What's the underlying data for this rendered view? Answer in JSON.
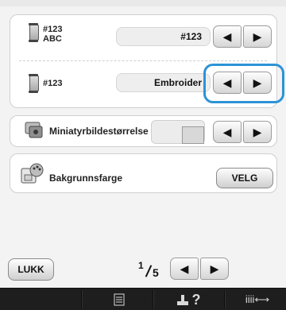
{
  "rows": [
    {
      "label_line1": "#123",
      "label_line2": "ABC",
      "value": "#123"
    },
    {
      "label": "#123",
      "value": "Embroider"
    },
    {
      "label": "Miniatyrbildestørrelse"
    },
    {
      "label": "Bakgrunnsfarge",
      "button": "VELG"
    }
  ],
  "footer": {
    "close_label": "LUKK",
    "page_current": "1",
    "page_total": "5"
  },
  "icons": {
    "left_arrow": "◀",
    "right_arrow": "▶",
    "question": "?",
    "bottom_right": "iiii⟷"
  },
  "colors": {
    "highlight": "#2d93d6"
  }
}
